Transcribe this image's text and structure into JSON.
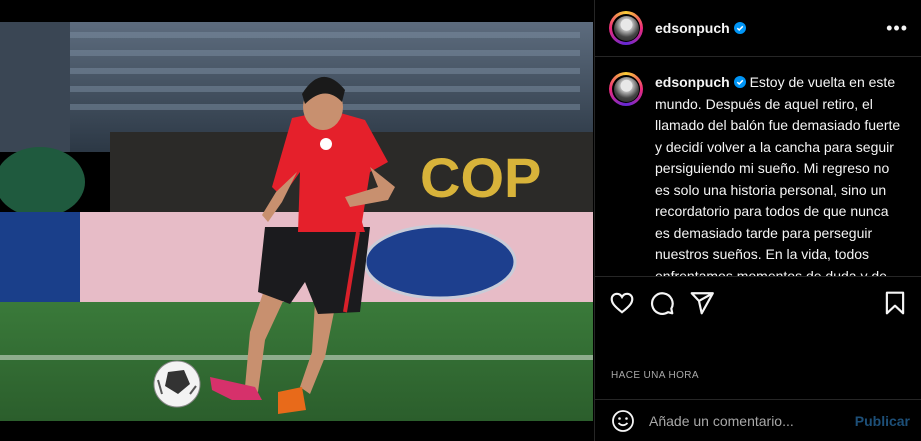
{
  "post": {
    "username": "edsonpuch",
    "caption_text": "Estoy de vuelta en este mundo. Después de aquel retiro, el llamado del balón fue demasiado fuerte y decidí volver a la cancha para seguir persiguiendo mi sueño. Mi regreso no es solo una historia personal, sino un recordatorio para todos de que nunca es demasiado tarde para perseguir nuestros sueños. En la vida, todos enfrentamos momentos de duda y de",
    "timestamp": "HACE UNA HORA"
  },
  "photo": {
    "banner_text": "COP"
  },
  "comment": {
    "placeholder": "Añade un comentario...",
    "publish_label": "Publicar"
  },
  "icons": {
    "more": "more-options-icon",
    "like": "heart-icon",
    "comment": "comment-icon",
    "share": "share-icon",
    "save": "bookmark-icon",
    "emoji": "emoji-icon",
    "verified": "verified-badge-icon"
  },
  "colors": {
    "background": "#000000",
    "verified": "#0095f6",
    "publish": "#1d4f78",
    "shirt": "#e5202b"
  }
}
